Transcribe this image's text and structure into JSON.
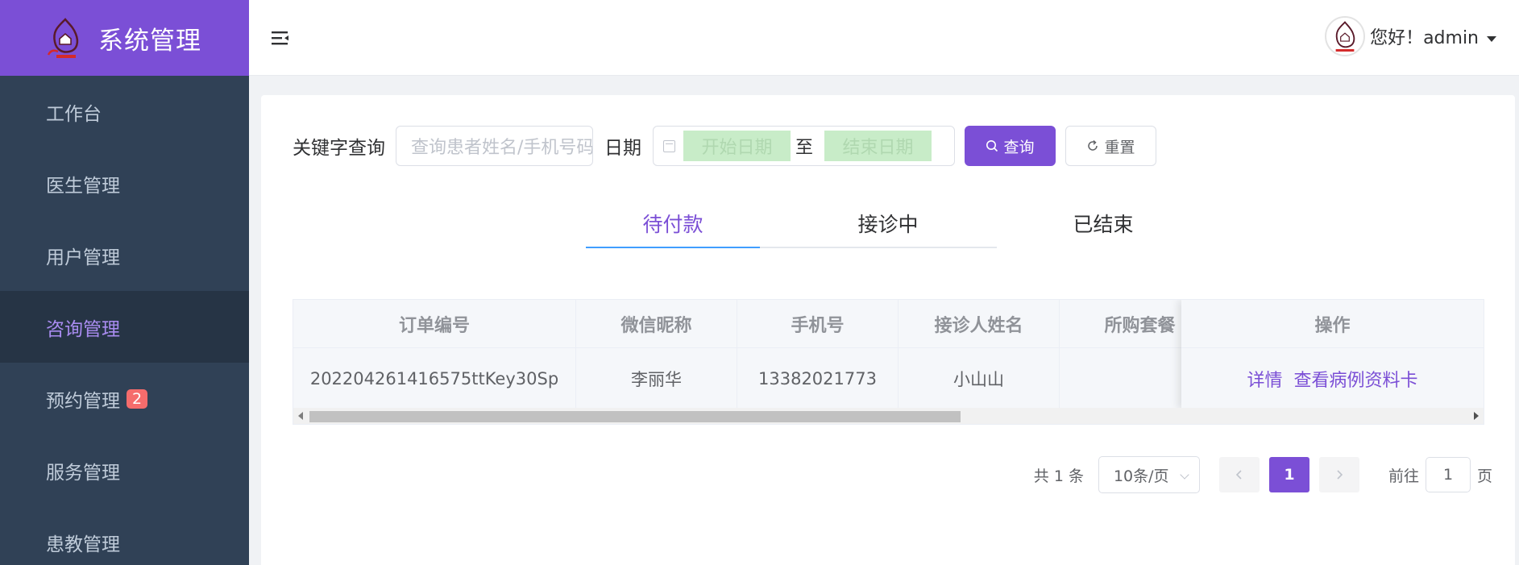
{
  "sidebar": {
    "title": "系统管理",
    "items": [
      {
        "label": "工作台"
      },
      {
        "label": "医生管理"
      },
      {
        "label": "用户管理"
      },
      {
        "label": "咨询管理"
      },
      {
        "label": "预约管理",
        "badge": "2"
      },
      {
        "label": "服务管理"
      },
      {
        "label": "患教管理"
      }
    ],
    "active_index": 3
  },
  "navbar": {
    "greeting": "您好！admin"
  },
  "filter": {
    "keyword_label": "关键字查询",
    "keyword_placeholder": "查询患者姓名/手机号码",
    "date_label": "日期",
    "start_placeholder": "开始日期",
    "range_separator": "至",
    "end_placeholder": "结束日期",
    "search_label": "查询",
    "reset_label": "重置"
  },
  "tabs": [
    {
      "label": "待付款"
    },
    {
      "label": "接诊中"
    },
    {
      "label": "已结束"
    }
  ],
  "table": {
    "headers": [
      "订单编号",
      "微信昵称",
      "手机号",
      "接诊人姓名",
      "所购套餐"
    ],
    "action_header": "操作",
    "rows": [
      {
        "order_no": "202204261416575ttKey30Sp",
        "nickname": "李丽华",
        "phone": "13382021773",
        "receiver": "小山山",
        "package": "",
        "actions": [
          "详情",
          "查看病例资料卡"
        ]
      }
    ]
  },
  "pagination": {
    "total": "共 1 条",
    "page_size": "10条/页",
    "current_page": "1",
    "goto_prefix": "前往",
    "goto_value": "1",
    "goto_suffix": "页"
  },
  "colors": {
    "accent": "#7b4fd6",
    "sidebar_bg": "#304156",
    "tab_ink": "#409eff",
    "badge": "#f56c6c"
  }
}
